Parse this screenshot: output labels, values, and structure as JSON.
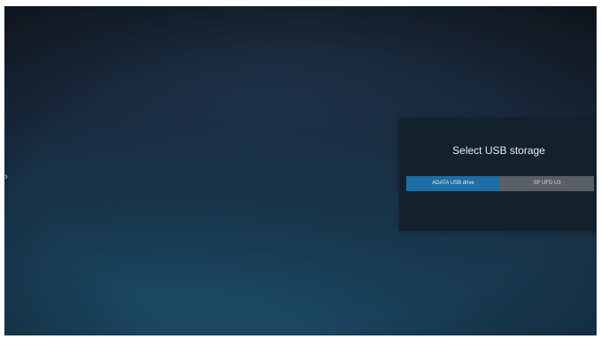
{
  "dialog": {
    "title": "Select USB storage",
    "options": [
      {
        "label": "ADATA USB drive",
        "selected": true
      },
      {
        "label": "SP UFD U3",
        "selected": false
      }
    ]
  },
  "nav": {
    "left_icon": "chevron-right-icon",
    "left_glyph": "›",
    "right_icon": "chevron-left-icon",
    "right_glyph": "‹"
  },
  "colors": {
    "selected_option": "#1d6ea4",
    "unselected_option": "#5a5f64",
    "dialog_background": "#13212d"
  }
}
